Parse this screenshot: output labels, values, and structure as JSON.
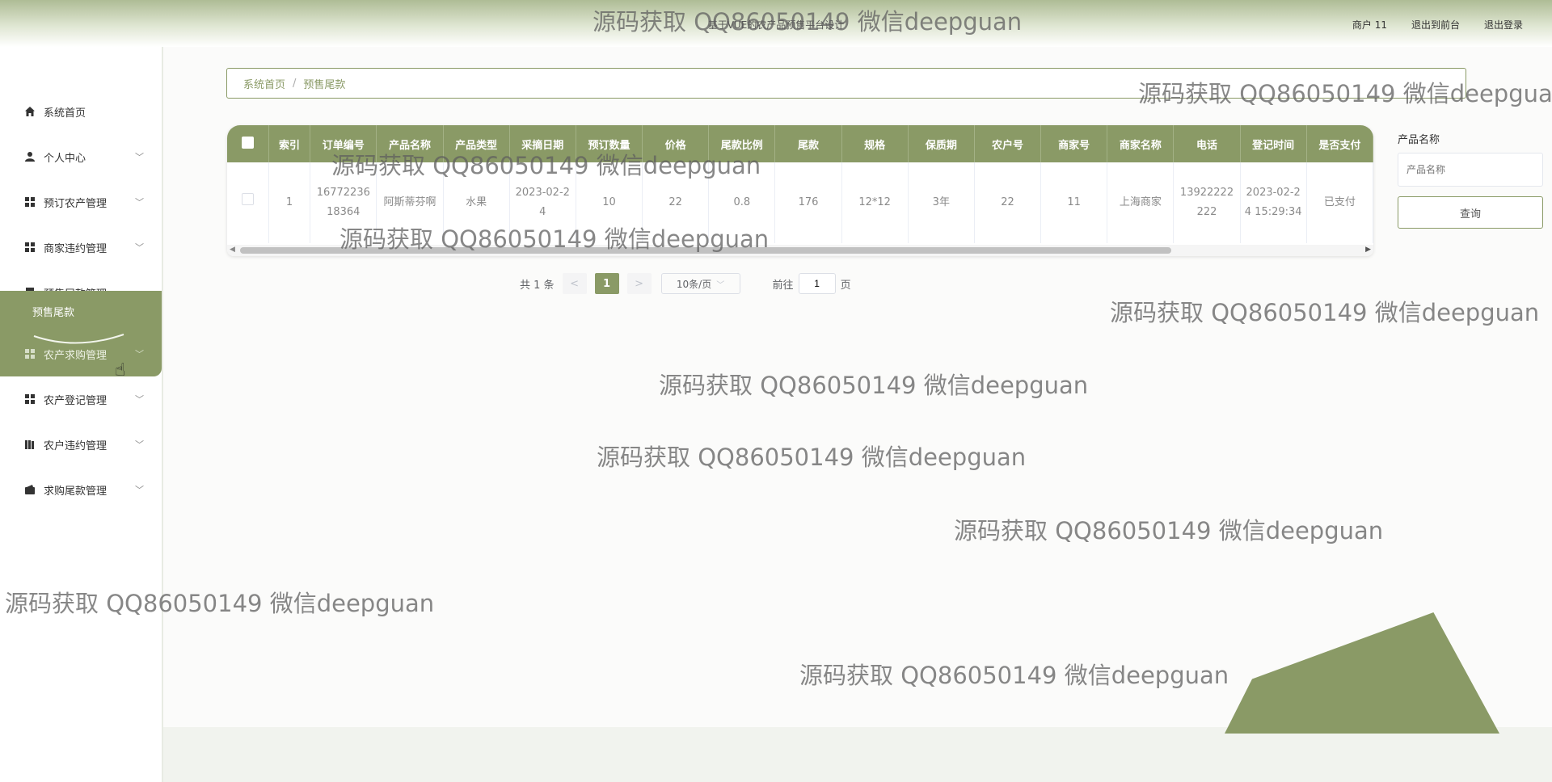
{
  "header": {
    "app_title": "基于VUE的农产品预售平台设计",
    "user_label": "商户 11",
    "back_front_label": "退出到前台",
    "logout_label": "退出登录"
  },
  "sidebar": {
    "items": [
      {
        "label": "系统首页",
        "icon": "home-icon"
      },
      {
        "label": "个人中心",
        "icon": "user-icon"
      },
      {
        "label": "预订农产管理",
        "icon": "grid-icon"
      },
      {
        "label": "商家违约管理",
        "icon": "grid-icon"
      },
      {
        "label": "预售尾款管理",
        "icon": "stamp-icon"
      },
      {
        "label": "农产求购管理",
        "icon": "grid-icon"
      },
      {
        "label": "农产登记管理",
        "icon": "grid-icon"
      },
      {
        "label": "农户违约管理",
        "icon": "book-icon"
      },
      {
        "label": "求购尾款管理",
        "icon": "wallet-icon"
      }
    ],
    "subitem": "预售尾款"
  },
  "breadcrumb": {
    "home": "系统首页",
    "separator": "/",
    "current": "预售尾款"
  },
  "table": {
    "columns": [
      "索引",
      "订单编号",
      "产品名称",
      "产品类型",
      "采摘日期",
      "预订数量",
      "价格",
      "尾款比例",
      "尾款",
      "规格",
      "保质期",
      "农户号",
      "商家号",
      "商家名称",
      "电话",
      "登记时间",
      "是否支付"
    ],
    "rows": [
      {
        "index": "1",
        "order_no": "1677223618364",
        "product_name": "阿斯蒂芬啊",
        "product_type": "水果",
        "pick_date": "2023-02-24",
        "quantity": "10",
        "price": "22",
        "ratio": "0.8",
        "balance": "176",
        "spec": "12*12",
        "shelf_life": "3年",
        "farmer_no": "22",
        "merchant_no": "11",
        "merchant_name": "上海商家",
        "phone": "13922222222",
        "reg_time": "2023-02-24 15:29:34",
        "paid": "已支付"
      }
    ]
  },
  "pagination": {
    "total": "共 1 条",
    "prev": "<",
    "current_page": "1",
    "next": ">",
    "page_size": "10条/页",
    "goto_prefix": "前往",
    "goto_value": "1",
    "goto_suffix": "页"
  },
  "search": {
    "label": "产品名称",
    "placeholder": "产品名称",
    "button": "查询"
  },
  "watermark": "源码获取 QQ86050149 微信deepguan",
  "colors": {
    "accent": "#8a9a66",
    "header_top": "#aebc95"
  }
}
